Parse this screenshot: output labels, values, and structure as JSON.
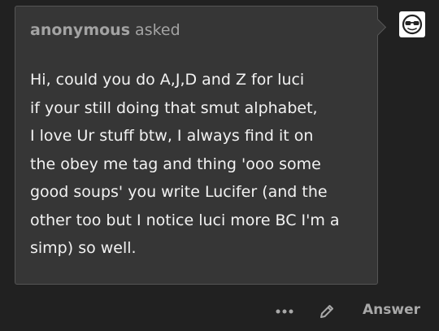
{
  "ask": {
    "asker_name": "anonymous",
    "asked_label": "asked",
    "question_lines": [
      "Hi, could you do A,J,D and Z for luci",
      "if your still doing that smut alphabet,",
      "I love Ur stuff btw, I always find it on",
      "the obey me tag and thing 'ooo some",
      "good soups' you write Lucifer (and the",
      "other too but I notice luci more BC I'm a",
      "simp) so well."
    ]
  },
  "avatar": {
    "icon": "sunglasses-face-icon"
  },
  "actions": {
    "more_icon": "ellipsis-icon",
    "edit_icon": "pencil-icon",
    "answer_label": "Answer"
  },
  "colors": {
    "background": "#212121",
    "card": "#363636",
    "text": "#f2f2f2",
    "muted": "#a3a3a3"
  }
}
